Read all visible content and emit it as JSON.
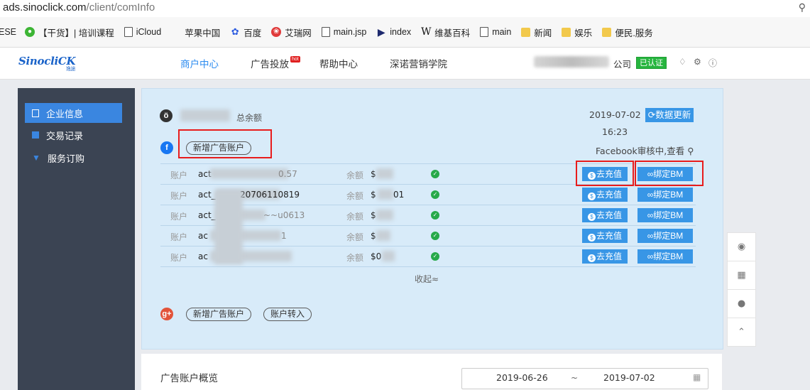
{
  "browser": {
    "url_domain": "ads.sinoclick.com",
    "url_path": "/client/comInfo",
    "zoom_icon": "zoom-icon"
  },
  "bookmarks": [
    {
      "label": "ESE",
      "icon": "none"
    },
    {
      "label": "【干货】| 培训课程",
      "icon": "wechat-icon"
    },
    {
      "label": "iCloud",
      "icon": "page-icon"
    },
    {
      "label": "苹果中国",
      "icon": "apple-icon"
    },
    {
      "label": "百度",
      "icon": "baidu-icon"
    },
    {
      "label": "艾瑞网",
      "icon": "iresearch-icon"
    },
    {
      "label": "main.jsp",
      "icon": "page-icon"
    },
    {
      "label": "index",
      "icon": "flag-icon"
    },
    {
      "label": "维基百科",
      "icon": "wikipedia-icon"
    },
    {
      "label": "main",
      "icon": "page-icon"
    },
    {
      "label": "新闻",
      "icon": "folder-icon"
    },
    {
      "label": "娱乐",
      "icon": "folder-icon"
    },
    {
      "label": "便民.服务",
      "icon": "folder-icon"
    }
  ],
  "nav": {
    "logo": "SinocliCK",
    "logo_sub": "逸途",
    "items": [
      {
        "label": "商户中心",
        "active": true
      },
      {
        "label": "广告投放",
        "badge": "hot"
      },
      {
        "label": "帮助中心"
      },
      {
        "label": "深诺营销学院"
      }
    ],
    "company_suffix": "公司",
    "verified": "已认证"
  },
  "sidebar": {
    "items": [
      {
        "label": "企业信息",
        "active": true
      },
      {
        "label": "交易记录"
      },
      {
        "label": "服务订购"
      }
    ]
  },
  "balance": {
    "label": "总余额",
    "date": "2019-07-02",
    "time": "16:23",
    "refresh": "数据更新"
  },
  "facebook": {
    "add_account": "新增广告账户",
    "status": "Facebook审核中,查看",
    "account_label": "账户",
    "balance_label": "余额",
    "recharge": "去充值",
    "bind_bm": "绑定BM",
    "accounts": [
      {
        "id_prefix": "act",
        "id_suffix": "0.57",
        "balance_prefix": "$"
      },
      {
        "id_prefix": "act_",
        "id_suffix": "20706110819",
        "balance_prefix": "$",
        "balance_suffix": "01"
      },
      {
        "id_prefix": "act_",
        "id_suffix": "~~u0613",
        "balance_prefix": "$"
      },
      {
        "id_prefix": "ac",
        "id_suffix": "1",
        "balance_prefix": "$"
      },
      {
        "id_prefix": "ac",
        "id_suffix": "",
        "balance_prefix": "$0"
      }
    ],
    "collapse": "收起≈"
  },
  "google": {
    "add_account": "新增广告账户",
    "transfer": "账户转入"
  },
  "overview": {
    "title": "广告账户概览",
    "date_start": "2019-06-26",
    "date_sep": "~",
    "date_end": "2019-07-02"
  }
}
